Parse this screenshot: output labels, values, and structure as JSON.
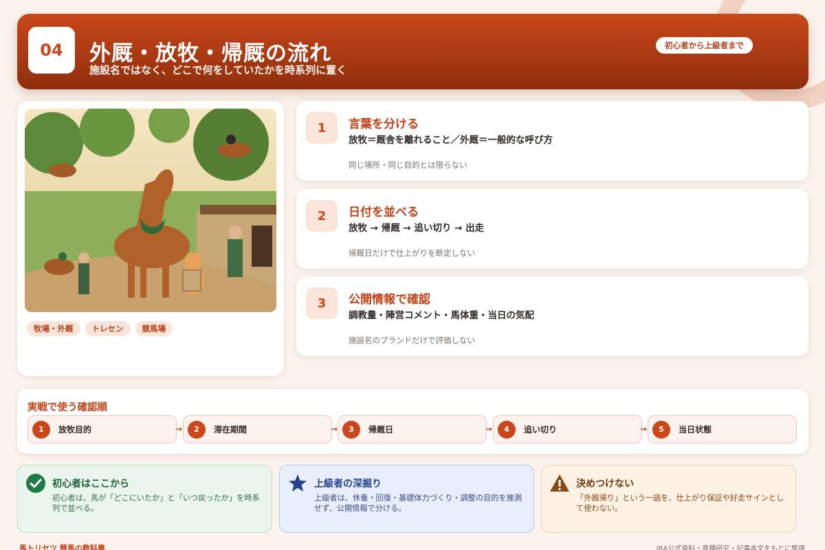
{
  "header": {
    "number": "04",
    "title": "外厩・放牧・帰厩の流れ",
    "subtitle": "施設名ではなく、どこで何をしていたかを時系列に置く",
    "level": "初心者から上級者まで"
  },
  "illustration": {
    "subject": "horse-farm-training-illustration",
    "tags": [
      "牧場・外厩",
      "トレセン",
      "競馬場"
    ]
  },
  "steps": [
    {
      "number": "1",
      "title": "言葉を分ける",
      "desc": "放牧＝厩舎を離れること／外厩＝一般的な呼び方",
      "note": "同じ場所・同じ目的とは限らない"
    },
    {
      "number": "2",
      "title": "日付を並べる",
      "desc": "放牧 → 帰厩 → 追い切り → 出走",
      "note": "帰厩日だけで仕上がりを断定しない"
    },
    {
      "number": "3",
      "title": "公開情報で確認",
      "desc": "調教量・陣営コメント・馬体重・当日の気配",
      "note": "施設名のブランドだけで評価しない"
    }
  ],
  "check_order": {
    "title": "実戦で使う確認順",
    "arrow": "→",
    "items": [
      {
        "number": "1",
        "label": "放牧目的"
      },
      {
        "number": "2",
        "label": "滞在期間"
      },
      {
        "number": "3",
        "label": "帰厩日"
      },
      {
        "number": "4",
        "label": "追い切り"
      },
      {
        "number": "5",
        "label": "当日状態"
      }
    ]
  },
  "boxes": {
    "beginner": {
      "icon": "check-circle-icon",
      "title": "初心者はここから",
      "text": "初心者は、馬が「どこにいたか」と「いつ戻ったか」を時系列で並べる。"
    },
    "advanced": {
      "icon": "star-icon",
      "title": "上級者の深掘り",
      "text": "上級者は、休養・回復・基礎体力づくり・調整の目的を推測せず、公開情報で分ける。"
    },
    "warning": {
      "icon": "warning-triangle-icon",
      "title": "決めつけない",
      "text": "「外厩帰り」という一語を、仕上がり保証や好走サインとして使わない。"
    }
  },
  "footer": {
    "brand": "馬トリセツ 競馬の教科書",
    "source": "JRA公式資料・育種研究・記事本文をもとに整理"
  },
  "colors": {
    "accent": "#c9471a",
    "accent_dark": "#8f2e0d",
    "green": "#1f7a45",
    "blue": "#23408a",
    "orange": "#8a4a14"
  }
}
